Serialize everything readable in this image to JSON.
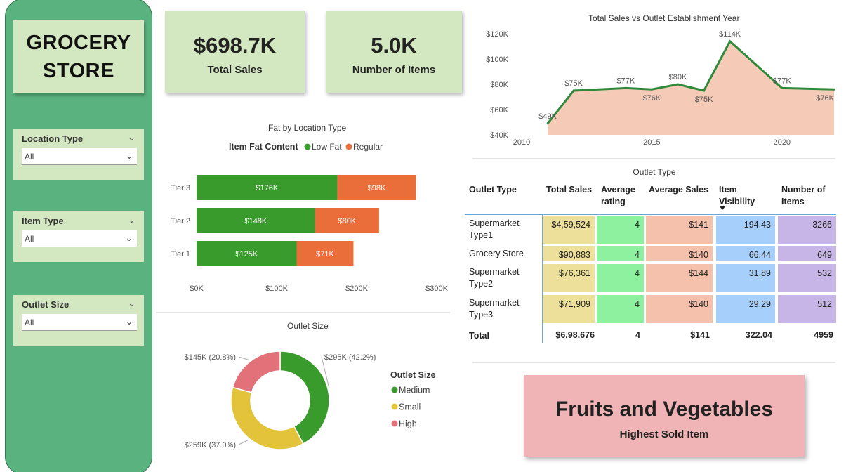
{
  "logo": {
    "line1": "GROCERY",
    "line2": "STORE"
  },
  "slicers": [
    {
      "title": "Location Type",
      "value": "All"
    },
    {
      "title": "Item Type",
      "value": "All"
    },
    {
      "title": "Outlet Size",
      "value": "All"
    }
  ],
  "kpis": {
    "total_sales": {
      "value": "$698.7K",
      "label": "Total Sales"
    },
    "items": {
      "value": "5.0K",
      "label": "Number of Items"
    }
  },
  "highest_item": {
    "value": "Fruits and Vegetables",
    "label": "Highest Sold Item"
  },
  "colors": {
    "sidebar": "#5ab27e",
    "card": "#d3e7c0",
    "low_fat": "#3a9b2d",
    "regular": "#e96e3a",
    "line": "#2e8a3a",
    "area": "#f5cbb8",
    "donut_medium": "#3a9b2d",
    "donut_small": "#e2c33a",
    "donut_high": "#e2717a",
    "col_sales": "#ece09b",
    "col_rating": "#8ef19f",
    "col_avg": "#f5c1ad",
    "col_vis": "#a6d0fb",
    "col_items": "#c7b5e8"
  },
  "icons": {
    "slicer_collapse": "chevron-down-icon",
    "dropdown": "chevron-down-icon",
    "sort": "sort-desc-icon"
  },
  "chart_data": [
    {
      "type": "area",
      "title": "Total Sales vs Outlet Establishment Year",
      "x": [
        2011,
        2012,
        2014,
        2015,
        2016,
        2017,
        2018,
        2020,
        2022
      ],
      "values": [
        49,
        75,
        77,
        76,
        80,
        75,
        114,
        77,
        76
      ],
      "labels": [
        "$49K",
        "$75K",
        "$77K",
        "$76K",
        "$80K",
        "$75K",
        "$114K",
        "$77K",
        "$76K"
      ],
      "xticks": [
        "2010",
        "2015",
        "2020"
      ],
      "yticks": [
        "$40K",
        "$60K",
        "$80K",
        "$100K",
        "$120K"
      ],
      "ylim": [
        40,
        120
      ],
      "xlim": [
        2010,
        2022
      ]
    },
    {
      "type": "bar",
      "title": "Fat by Location Type",
      "legend_title": "Item Fat Content",
      "categories": [
        "Tier 3",
        "Tier 2",
        "Tier 1"
      ],
      "series": [
        {
          "name": "Low Fat",
          "values": [
            176,
            148,
            125
          ],
          "labels": [
            "$176K",
            "$148K",
            "$125K"
          ]
        },
        {
          "name": "Regular",
          "values": [
            98,
            80,
            71
          ],
          "labels": [
            "$98K",
            "$80K",
            "$71K"
          ]
        }
      ],
      "xticks": [
        "$0K",
        "$100K",
        "$200K",
        "$300K"
      ],
      "xlim": [
        0,
        300
      ]
    },
    {
      "type": "pie",
      "title": "Outlet Size",
      "legend_title": "Outlet Size",
      "categories": [
        "Medium",
        "Small",
        "High"
      ],
      "values": [
        295,
        259,
        145
      ],
      "labels": [
        "$295K (42.2%)",
        "$259K (37.0%)",
        "$145K (20.8%)"
      ]
    },
    {
      "type": "table",
      "title": "Outlet Type",
      "columns": [
        "Outlet Type",
        "Total Sales",
        "Average rating",
        "Average Sales",
        "Item Visibility",
        "Number of Items"
      ],
      "rows": [
        {
          "name": "Supermarket Type1",
          "sales": "$4,59,524",
          "rating": "4",
          "avg": "$141",
          "vis": "194.43",
          "items": "3266"
        },
        {
          "name": "Grocery Store",
          "sales": "$90,883",
          "rating": "4",
          "avg": "$140",
          "vis": "66.44",
          "items": "649"
        },
        {
          "name": "Supermarket Type2",
          "sales": "$76,361",
          "rating": "4",
          "avg": "$144",
          "vis": "31.89",
          "items": "532"
        },
        {
          "name": "Supermarket Type3",
          "sales": "$71,909",
          "rating": "4",
          "avg": "$140",
          "vis": "29.29",
          "items": "512"
        }
      ],
      "total": {
        "name": "Total",
        "sales": "$6,98,676",
        "rating": "4",
        "avg": "$141",
        "vis": "322.04",
        "items": "4959"
      }
    }
  ]
}
